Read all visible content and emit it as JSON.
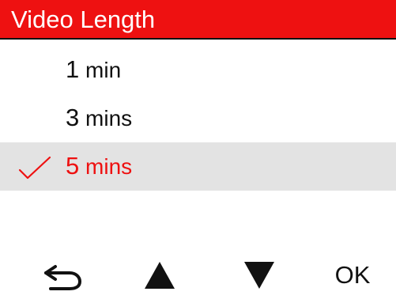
{
  "header": {
    "title": "Video Length"
  },
  "menu": {
    "items": [
      {
        "value": "1",
        "unit": "min",
        "selected": false
      },
      {
        "value": "3",
        "unit": "mins",
        "selected": false
      },
      {
        "value": "5",
        "unit": "mins",
        "selected": true
      }
    ]
  },
  "footer": {
    "back_icon": "back-arrow-icon",
    "up_icon": "up-triangle-icon",
    "down_icon": "down-triangle-icon",
    "ok_label": "OK"
  },
  "colors": {
    "header_bg": "#ee1111",
    "header_text": "#ffffff",
    "selected_text": "#ee1111",
    "selected_bg": "#e3e3e3",
    "text": "#111111"
  }
}
